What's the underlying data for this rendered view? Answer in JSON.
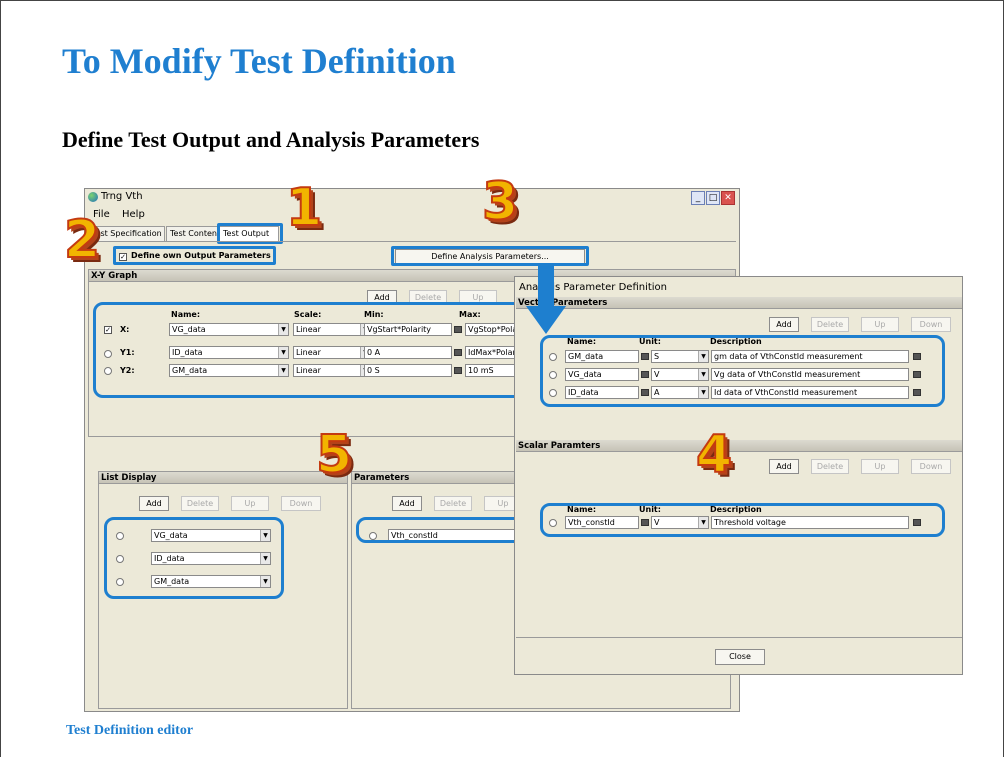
{
  "slide": {
    "title": "To Modify Test Definition",
    "subtitle": "Define Test Output and Analysis Parameters",
    "caption": "Test Definition editor"
  },
  "steps": [
    "1",
    "2",
    "3",
    "4",
    "5"
  ],
  "main_window": {
    "title": "Trng Vth",
    "menu": [
      "File",
      "Help"
    ],
    "tabs": [
      "Test Specification",
      "Test Contents",
      "Test Output"
    ],
    "define_own_label": "Define own Output Parameters",
    "define_own_checked": true,
    "define_analysis_button": "Define Analysis Parameters...",
    "xy_graph": {
      "header": "X-Y Graph",
      "buttons": [
        "Add",
        "Delete",
        "Up"
      ],
      "columns": [
        "Name:",
        "Scale:",
        "Min:",
        "Max:"
      ],
      "rows": [
        {
          "label": "X:",
          "name": "VG_data",
          "scale": "Linear",
          "min": "VgStart*Polarity",
          "max": "VgStop*Polar"
        },
        {
          "label": "Y1:",
          "name": "ID_data",
          "scale": "Linear",
          "min": "0 A",
          "max": "IdMax*Polarit"
        },
        {
          "label": "Y2:",
          "name": "GM_data",
          "scale": "Linear",
          "min": "0 S",
          "max": "10 mS"
        }
      ]
    },
    "list_display": {
      "header": "List Display",
      "buttons": [
        "Add",
        "Delete",
        "Up",
        "Down"
      ],
      "items": [
        "VG_data",
        "ID_data",
        "GM_data"
      ]
    },
    "parameters": {
      "header": "Parameters",
      "buttons": [
        "Add",
        "Delete",
        "Up"
      ],
      "items": [
        "Vth_constId"
      ]
    }
  },
  "analysis_dialog": {
    "title": "Analysis Parameter Definition",
    "vector": {
      "header": "Vector Parameters",
      "buttons": [
        "Add",
        "Delete",
        "Up",
        "Down"
      ],
      "columns": [
        "Name:",
        "Unit:",
        "Description"
      ],
      "rows": [
        {
          "name": "GM_data",
          "unit": "S",
          "desc": "gm data of VthConstId measurement"
        },
        {
          "name": "VG_data",
          "unit": "V",
          "desc": "Vg data of VthConstId measurement"
        },
        {
          "name": "ID_data",
          "unit": "A",
          "desc": "Id data of VthConstId measurement"
        }
      ]
    },
    "scalar": {
      "header": "Scalar Paramters",
      "buttons": [
        "Add",
        "Delete",
        "Up",
        "Down"
      ],
      "columns": [
        "Name:",
        "Unit:",
        "Description"
      ],
      "rows": [
        {
          "name": "Vth_constId",
          "unit": "V",
          "desc": "Threshold voltage"
        }
      ]
    },
    "close_button": "Close"
  }
}
